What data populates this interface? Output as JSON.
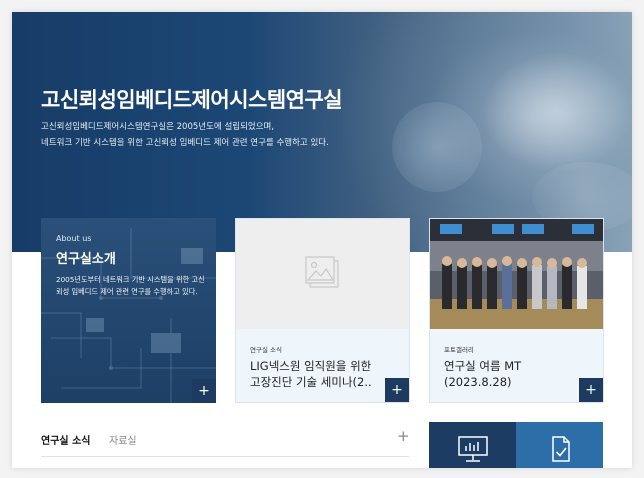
{
  "hero": {
    "title": "고신뢰성임베디드제어시스템연구실",
    "desc_line1": "고신뢰성임베디드제어시스템연구실은 2005년도에 설립되었으며,",
    "desc_line2": "네트워크 기반 시스템을 위한 고신뢰성 임베디드 제어 관련 연구를 수행하고 있다."
  },
  "about": {
    "eyebrow": "About us",
    "title": "연구실소개",
    "desc": "2005년도부터 네트워크 기반 시스템을 위한 고신뢰성 임베디드 제어 관련 연구를 수행하고 있다."
  },
  "news_card": {
    "category": "연구실 소식",
    "headline": "LIG넥스원 임직원을 위한 고장진단 기술 세미나(2.."
  },
  "photo_card": {
    "category": "포토갤러리",
    "headline": "연구실 여름 MT (2023.8.28)"
  },
  "tabs": {
    "active": "연구실 소식",
    "second": "자료실"
  },
  "icons": {
    "plus": "+",
    "news_placeholder": "image-placeholder-icon",
    "quick1": "monitor-chart-icon",
    "quick2": "document-check-icon"
  },
  "colors": {
    "navy": "#1d3b61",
    "blue": "#2c6ea8",
    "card_bg": "#eef5fb"
  }
}
